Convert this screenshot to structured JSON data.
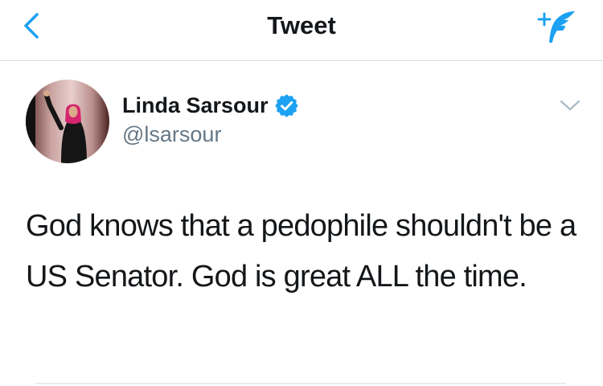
{
  "nav": {
    "title": "Tweet",
    "back_icon": "chevron-left-icon",
    "compose_icon": "compose-tweet-icon",
    "accent_color": "#1da1f2"
  },
  "tweet": {
    "author_name": "Linda Sarsour",
    "author_handle": "@lsarsour",
    "verified": true,
    "verified_icon": "verified-badge-icon",
    "menu_icon": "chevron-down-icon",
    "text": "God knows that a pedophile shouldn't be a US Senator. God is great ALL the time."
  }
}
